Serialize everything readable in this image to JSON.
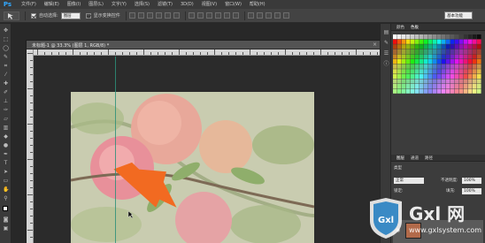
{
  "app": {
    "logo": "Ps"
  },
  "menubar": {
    "items": [
      "文件(F)",
      "编辑(E)",
      "图像(I)",
      "图层(L)",
      "文字(Y)",
      "选择(S)",
      "滤镜(T)",
      "3D(D)",
      "视图(V)",
      "窗口(W)",
      "帮助(H)"
    ]
  },
  "options": {
    "auto_select_label": "自动选择:",
    "auto_select_value": "图层",
    "show_transform_label": "显示变换控件",
    "workspace": "基本功能"
  },
  "document": {
    "title": "未标题-1 @ 33.3% (图层 1, RGB/8) *",
    "close": "×"
  },
  "panels": {
    "swatch_tabs": [
      "颜色",
      "色板"
    ],
    "layer_tabs": [
      "图层",
      "通道",
      "路径"
    ],
    "kind_label": "类型",
    "blend_mode": "正常",
    "opacity_label": "不透明度:",
    "opacity_value": "100%",
    "lock_label": "锁定:",
    "fill_label": "填充:",
    "fill_value": "100%"
  },
  "watermark": {
    "brand": "Gxl 网",
    "url": "www.gxlsystem.com"
  },
  "colors": {
    "accent_arrow": "#f26a21",
    "guide": "#2d8f79",
    "ps_blue": "#31a8ff"
  }
}
